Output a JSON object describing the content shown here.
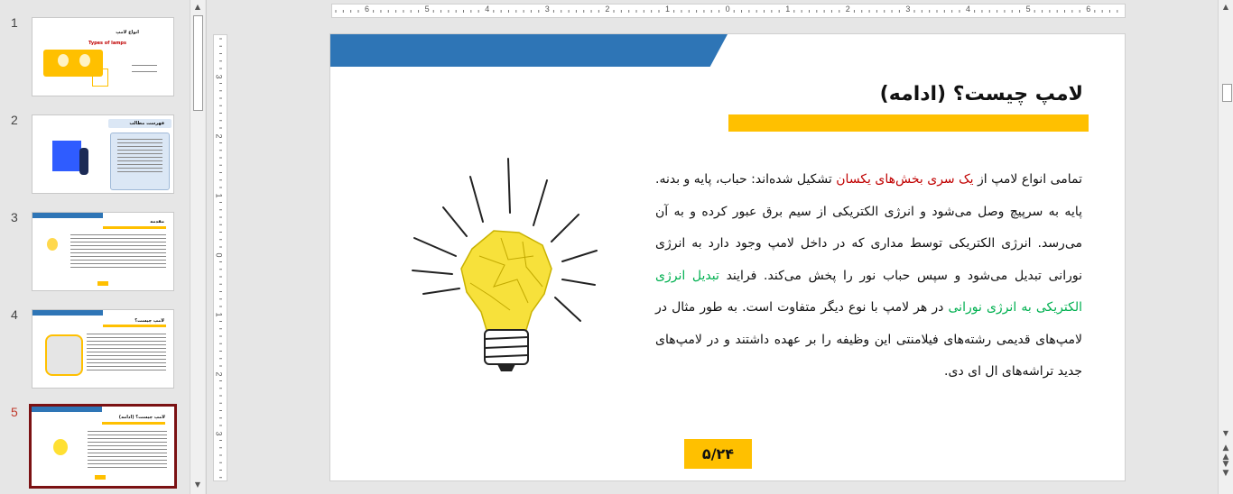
{
  "thumbnails": [
    {
      "num": "1",
      "title": "انواع لامپ",
      "subtitle": "Types of lamps",
      "active": false
    },
    {
      "num": "2",
      "title": "فهرست مطالب",
      "active": false
    },
    {
      "num": "3",
      "title": "مقدمه",
      "active": false
    },
    {
      "num": "4",
      "title": "لامپ چیست؟",
      "active": false
    },
    {
      "num": "5",
      "title": "لامپ چیست؟ (ادامه)",
      "active": true
    }
  ],
  "ruler": {
    "horizontal": [
      "6",
      "5",
      "4",
      "3",
      "2",
      "1",
      "0",
      "1",
      "2",
      "3",
      "4",
      "5",
      "6"
    ],
    "vertical": [
      "3",
      "2",
      "1",
      "0",
      "1",
      "2",
      "3"
    ]
  },
  "slide": {
    "title": "لامپ چیست؟ (ادامه)",
    "body": {
      "p1": "تمامی انواع لامپ از ",
      "red": "یک سری بخش‌های یکسان",
      "p2": " تشکیل شده‌اند: حباب، پایه و بدنه. پایه به سرپیچ وصل می‌شود و انرژی الکتریکی از سیم برق عبور کرده و به آن می‌رسد. انرژی الکتریکی توسط مداری که در داخل لامپ وجود دارد به انرژی نورانی تبدیل می‌شود و سپس حباب نور را پخش می‌کند. فرایند ",
      "green": "تبدیل انرژی الکتریکی به انرژی نورانی",
      "p3": " در هر لامپ با نوع دیگر متفاوت است. به طور مثال در لامپ‌های قدیمی رشته‌های فیلامنتی این وظیفه را بر عهده داشتند و در لامپ‌های جدید تراشه‌های ال ای دی."
    },
    "page_number": "۵/۲۴"
  },
  "colors": {
    "accent_blue": "#2e75b6",
    "accent_yellow": "#ffc000",
    "highlight_red": "#c00000",
    "highlight_green": "#00b050",
    "selected_border": "#7b1113"
  },
  "icons": {
    "scroll_up": "triangle-up",
    "scroll_down": "triangle-down",
    "prev_slide": "double-chevron-up",
    "next_slide": "double-chevron-down"
  }
}
